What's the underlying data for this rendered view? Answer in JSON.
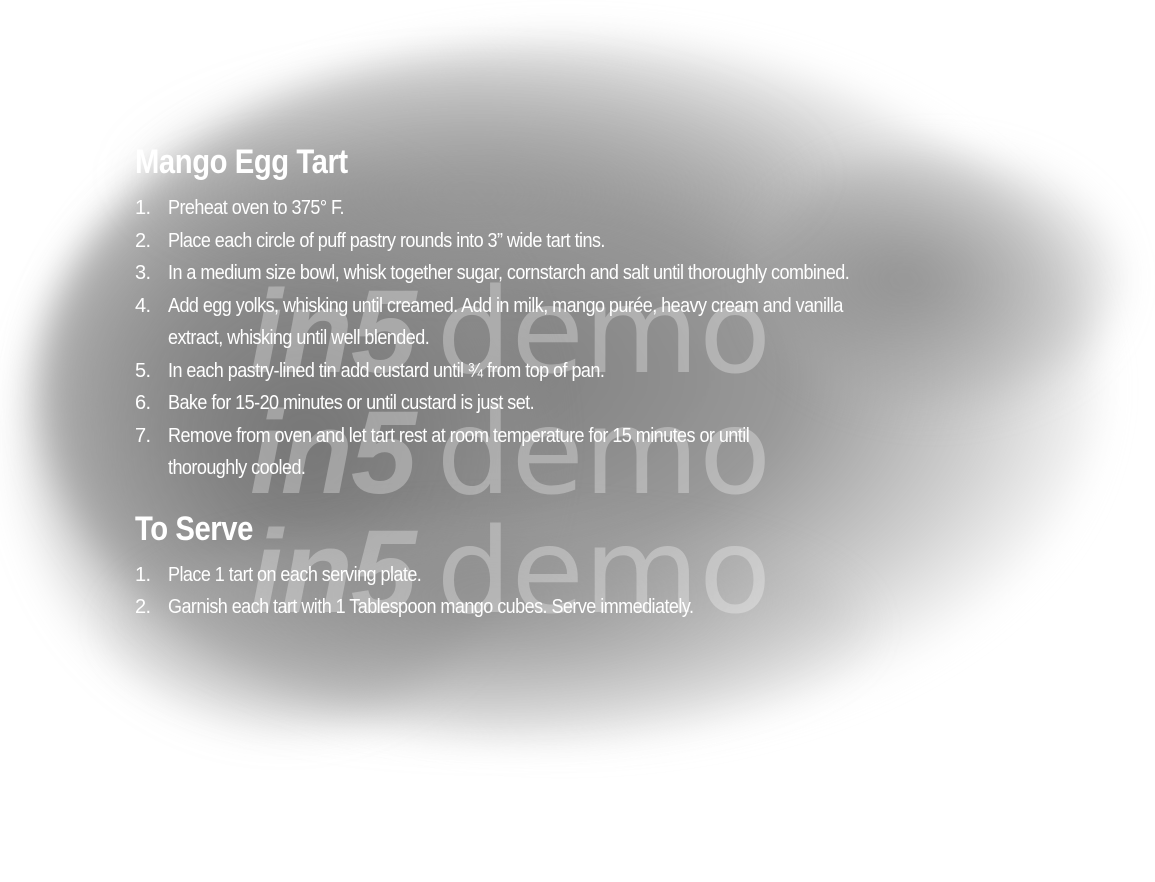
{
  "recipe": {
    "title": "Mango Egg Tart",
    "steps": [
      {
        "num": "1.",
        "lines": [
          "Preheat oven to 375° F."
        ]
      },
      {
        "num": "2.",
        "lines": [
          "Place each circle of puff pastry rounds into 3” wide tart tins."
        ]
      },
      {
        "num": "3.",
        "lines": [
          "In a medium size bowl, whisk together sugar, cornstarch and salt until thoroughly combined."
        ]
      },
      {
        "num": "4.",
        "lines": [
          "Add egg yolks, whisking until creamed. Add in milk, mango purée, heavy cream and vanilla",
          "extract, whisking until well blended."
        ]
      },
      {
        "num": "5.",
        "lines": [
          "In each pastry-lined tin add custard until ¾ from top of pan."
        ]
      },
      {
        "num": "6.",
        "lines": [
          "Bake for 15-20 minutes or until custard is just set."
        ]
      },
      {
        "num": "7.",
        "lines": [
          "Remove from oven and let tart rest at room temperature for 15 minutes or until",
          "thoroughly cooled."
        ]
      }
    ]
  },
  "serve": {
    "title": "To Serve",
    "steps": [
      {
        "num": "1.",
        "lines": [
          "Place 1 tart on each serving plate."
        ]
      },
      {
        "num": "2.",
        "lines": [
          "Garnish each tart with 1 Tablespoon mango cubes. Serve immediately."
        ]
      }
    ]
  },
  "watermark": {
    "strong": "in5",
    "light": "demo"
  },
  "colors": {
    "text": "#ffffff",
    "backdrop": "#878787",
    "page": "#ffffff"
  }
}
